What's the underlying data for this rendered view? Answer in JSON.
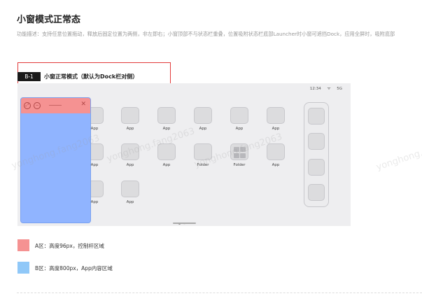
{
  "page": {
    "title": "小窗模式正常态",
    "description": "功能描述：支持任意位置拖动，释放后固定位置为两侧，非左即右；小窗顶部不与状态栏重叠，位置吸附状态栏底部Launcher时小窗可遮挡Dock，应用全屏时，吸附底部"
  },
  "section": {
    "badge": "B-1",
    "title": "小窗正常模式（默认为Dock栏对侧）"
  },
  "device": {
    "status": {
      "time": "12:34",
      "wifi_icon": "wifi-icon",
      "network": "5G"
    },
    "apps": [
      "App",
      "App",
      "App",
      "App",
      "App",
      "App",
      "App",
      "App",
      "App",
      "Folder",
      "App",
      "App",
      "App"
    ],
    "dock_count": 4,
    "page_dots": {
      "total": 2,
      "active": 1
    },
    "small_window": {
      "close_glyph": "✕"
    }
  },
  "legend": [
    {
      "label": "A区：高度96px，控制杆区域",
      "color": "#f59292"
    },
    {
      "label": "B区：高度800px，App内容区域",
      "color": "#90c8f8"
    }
  ],
  "watermark": "yonghong.fang2063",
  "colors": {
    "highlight_border": "#e23b3b",
    "badge_bg": "#1a1a1a"
  }
}
